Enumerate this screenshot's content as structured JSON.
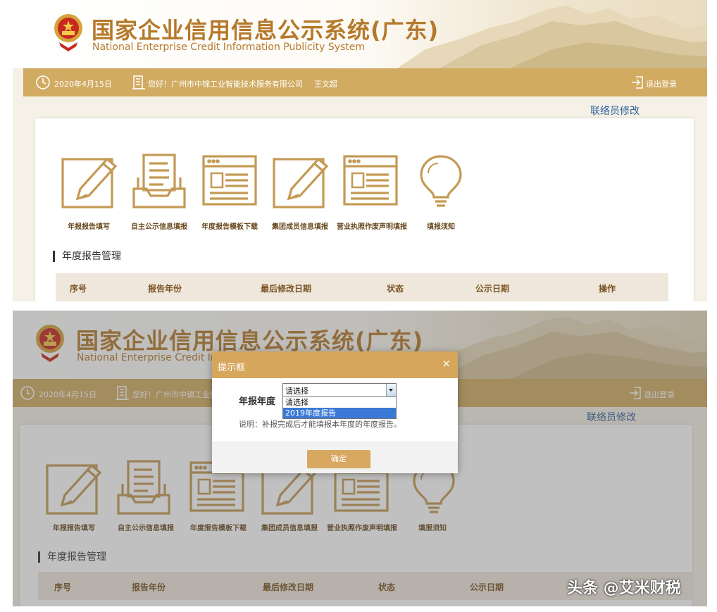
{
  "header": {
    "title_cn": "国家企业信用信息公示系统(广东)",
    "title_en": "National Enterprise Credit Information Publicity System"
  },
  "topbar": {
    "date": "2020年4月15日",
    "greeting": "您好！广州市中锦工业智能技术服务有限公司",
    "user": "王文超",
    "logout": "退出登录"
  },
  "contact_link": "联络员修改",
  "menu": [
    {
      "label": "年报报告填写",
      "icon": "edit-icon"
    },
    {
      "label": "自主公示信息填报",
      "icon": "inbox-icon"
    },
    {
      "label": "年度报告模板下载",
      "icon": "browser-template-icon"
    },
    {
      "label": "集团成员信息填报",
      "icon": "edit-icon"
    },
    {
      "label": "营业执照作废声明填报",
      "icon": "browser-template-icon"
    },
    {
      "label": "填报须知",
      "icon": "lightbulb-icon"
    }
  ],
  "section_title": "年度报告管理",
  "table": {
    "headers": [
      "序号",
      "报告年份",
      "最后修改日期",
      "状态",
      "公示日期",
      "操作"
    ]
  },
  "dialog": {
    "title": "提示框",
    "close": "×",
    "field_label": "年报年度",
    "select_value": "请选择",
    "options": [
      "请选择",
      "2019年度报告"
    ],
    "note": "说明：补报完成后才能填报本年度的年度报告。",
    "confirm": "确定"
  },
  "watermark": "头条 @艾米财税",
  "colors": {
    "accent": "#d1ab62",
    "title": "#b5792b",
    "link": "#2f5f9e",
    "highlight": "#3a7ad6"
  }
}
